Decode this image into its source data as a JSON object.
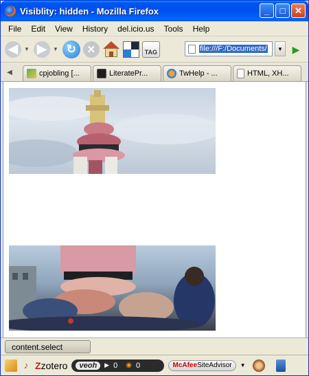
{
  "window": {
    "title": "Visiblity: hidden - Mozilla Firefox",
    "minimize": "_",
    "maximize": "□",
    "close": "✕"
  },
  "menu": [
    "File",
    "Edit",
    "View",
    "History",
    "del.icio.us",
    "Tools",
    "Help"
  ],
  "toolbar": {
    "back_icon": "◀",
    "forward_icon": "▶",
    "reload_icon": "↻",
    "stop_icon": "✕",
    "tag_label": "TAG",
    "url_value": "file:///F:/Documents/",
    "go_icon": "▶"
  },
  "tabs": [
    {
      "label": "cpjobling [..."
    },
    {
      "label": "LiteratePr..."
    },
    {
      "label": "TwHelp - ..."
    },
    {
      "label": "HTML, XH..."
    }
  ],
  "status": {
    "tab_label": "content.select",
    "zotero": "zotero",
    "veoh_logo": "veoh",
    "veoh_count1": "0",
    "veoh_count2": "0",
    "mcafee": "McAfee",
    "siteadvisor": "SiteAdvisor"
  },
  "colors": {
    "titlebar": "#0050EE",
    "url_highlight": "#316AC5",
    "go_arrow": "#2B9A2B"
  }
}
